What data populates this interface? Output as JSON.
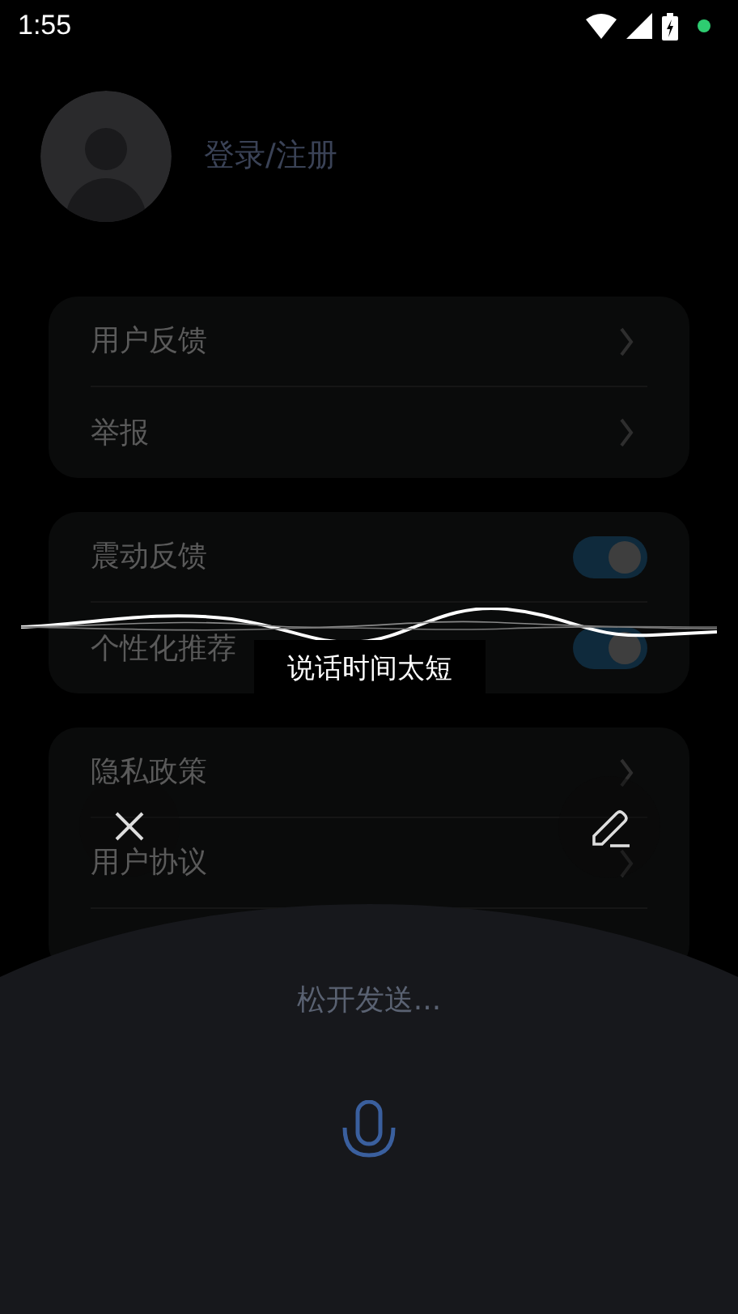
{
  "status_bar": {
    "time": "1:55"
  },
  "profile": {
    "login_label": "登录/注册"
  },
  "groups": [
    {
      "items": [
        {
          "label": "用户反馈",
          "kind": "link"
        },
        {
          "label": "举报",
          "kind": "link"
        }
      ]
    },
    {
      "items": [
        {
          "label": "震动反馈",
          "kind": "toggle",
          "on": true
        },
        {
          "label": "个性化推荐",
          "kind": "toggle",
          "on": true
        }
      ]
    },
    {
      "items": [
        {
          "label": "隐私政策",
          "kind": "link"
        },
        {
          "label": "用户协议",
          "kind": "link"
        }
      ]
    }
  ],
  "voice_overlay": {
    "toast": "说话时间太短",
    "hint": "松开发送..."
  }
}
